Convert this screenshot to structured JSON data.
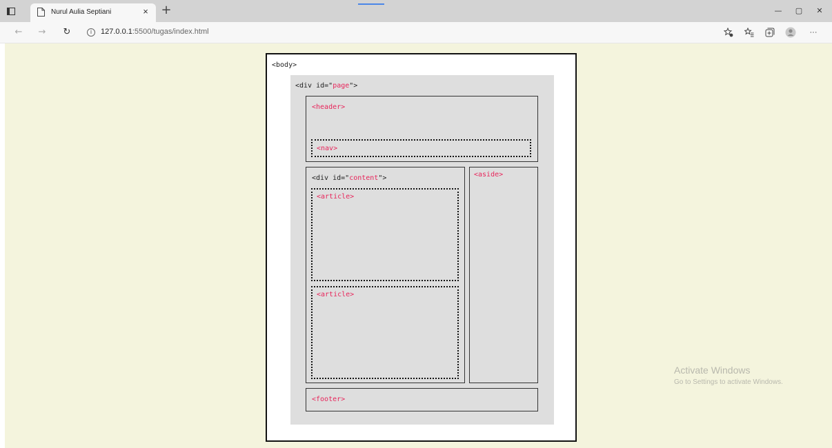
{
  "browser": {
    "tab_title": "Nurul Aulia Septiani",
    "tab_close": "×",
    "new_tab": "+",
    "address": {
      "host": "127.0.0.1",
      "rest": ":5500/tugas/index.html"
    },
    "window_controls": {
      "minimize": "—",
      "restore": "▢",
      "close": "✕"
    },
    "icons": [
      "tab-actions-icon",
      "page-icon",
      "back-icon",
      "forward-icon",
      "refresh-icon",
      "info-icon",
      "add-favorite-icon",
      "favorites-icon",
      "collections-icon",
      "profile-icon",
      "more-icon"
    ],
    "more_label": "···"
  },
  "diagram": {
    "body_label": "<body>",
    "page_div": {
      "open": "<div id=\"",
      "value": "page",
      "close": "\">"
    },
    "header_label": "<header>",
    "nav_label": "<nav>",
    "content_div": {
      "open": "<div id=\"",
      "value": "content",
      "close": "\">"
    },
    "articles": [
      "<article>",
      "<article>"
    ],
    "aside_label": "<aside>",
    "footer_label": "<footer>",
    "colors": {
      "tag": "#e8245a",
      "text": "#1e1e1e",
      "box_fill": "#dedede",
      "page_bg": "#f4f4dd"
    }
  },
  "watermark": {
    "title": "Activate Windows",
    "subtitle": "Go to Settings to activate Windows."
  }
}
